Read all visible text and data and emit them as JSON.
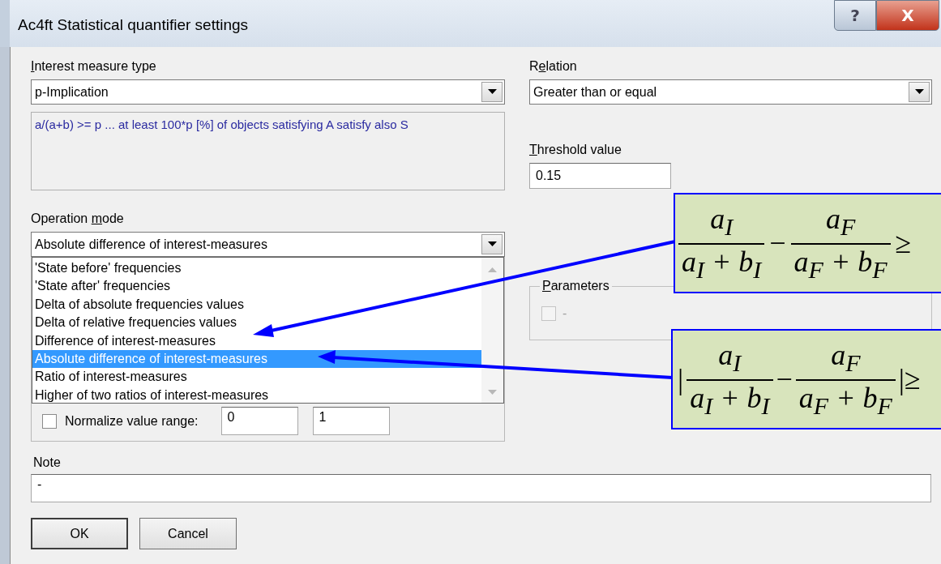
{
  "window": {
    "title": "Ac4ft Statistical quantifier settings",
    "buttons": [
      {
        "kind": "help",
        "label": "?"
      },
      {
        "kind": "close",
        "label": "X"
      }
    ]
  },
  "interest_measure_type": {
    "label": "Interest measure type",
    "value": "p-Implication",
    "description": "a/(a+b) >= p ... at least 100*p [%] of objects satisfying A satisfy also S"
  },
  "relation": {
    "label": "Relation",
    "value": "Greater than or equal"
  },
  "threshold": {
    "label": "Threshold value",
    "value": "0.15"
  },
  "operation_mode": {
    "label": "Operation mode",
    "value": "Absolute difference of interest-measures",
    "options": [
      {
        "label": "'State before' frequencies",
        "selected": false
      },
      {
        "label": "'State after' frequencies",
        "selected": false
      },
      {
        "label": "Delta of absolute frequencies values",
        "selected": false
      },
      {
        "label": "Delta of relative frequencies values",
        "selected": false
      },
      {
        "label": "Difference of interest-measures",
        "selected": false
      },
      {
        "label": "Absolute difference of interest-measures",
        "selected": true
      },
      {
        "label": "Ratio of interest-measures",
        "selected": false
      },
      {
        "label": "Higher of two ratios of interest-measures",
        "selected": false
      }
    ],
    "normalize": {
      "label": "Normalize value range:",
      "checked": false,
      "from": "0",
      "to": "1"
    }
  },
  "parameters": {
    "label": "Parameters",
    "checkbox": {
      "label": "-",
      "checked": false,
      "disabled": true
    }
  },
  "note": {
    "label": "Note",
    "value": "-"
  },
  "buttons": [
    {
      "label": "OK",
      "default": true
    },
    {
      "label": "Cancel",
      "default": false
    }
  ],
  "formulas": [
    {
      "num1": "a$_{I}$",
      "den1": "a$_{I}$ + b$_{I}$",
      "op": "−",
      "num2": "a$_{F}$",
      "den2": "a$_{F}$ + b$_{F}$",
      "tail": "≥"
    },
    {
      "lead": "|",
      "num1": "a$_{I}$",
      "den1": "a$_{I}$ + b$_{I}$",
      "op": "−",
      "num2": "a$_{F}$",
      "den2": "a$_{F}$ + b$_{F}$",
      "tail": "|≥"
    }
  ]
}
